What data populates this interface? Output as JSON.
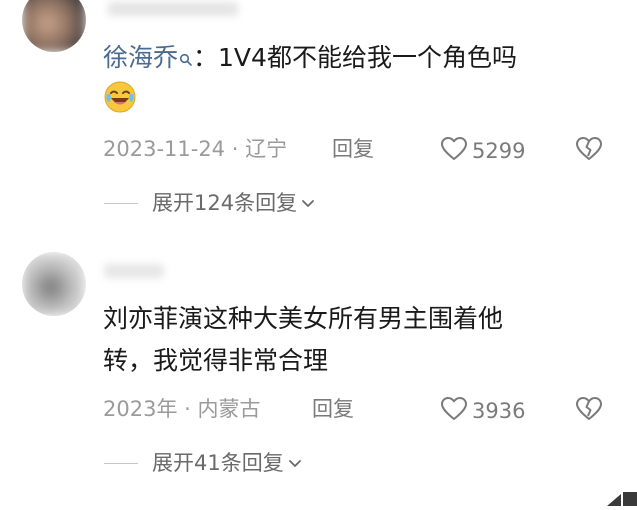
{
  "comments": [
    {
      "username": "徐海乔",
      "separator": "：",
      "text_first_line": "1V4都不能给我一个角色吗",
      "emoji": "crying-laughing-face",
      "date_location": "2023-11-24 · 辽宁",
      "reply_label": "回复",
      "likes": "5299",
      "expand_label": "展开124条回复"
    },
    {
      "text_lines": [
        "刘亦菲演这种大美女所有男主围着他",
        "转，我觉得非常合理"
      ],
      "date_location": "2023年 · 内蒙古",
      "reply_label": "回复",
      "likes": "3936",
      "expand_label": "展开41条回复"
    }
  ],
  "colors": {
    "username": "#4a6b8f",
    "text": "#1a1a1a",
    "meta": "#9a9a9a",
    "action": "#7a7a7a"
  },
  "icons": [
    "search-icon",
    "heart-icon",
    "dislike-icon",
    "chevron-down-icon"
  ]
}
